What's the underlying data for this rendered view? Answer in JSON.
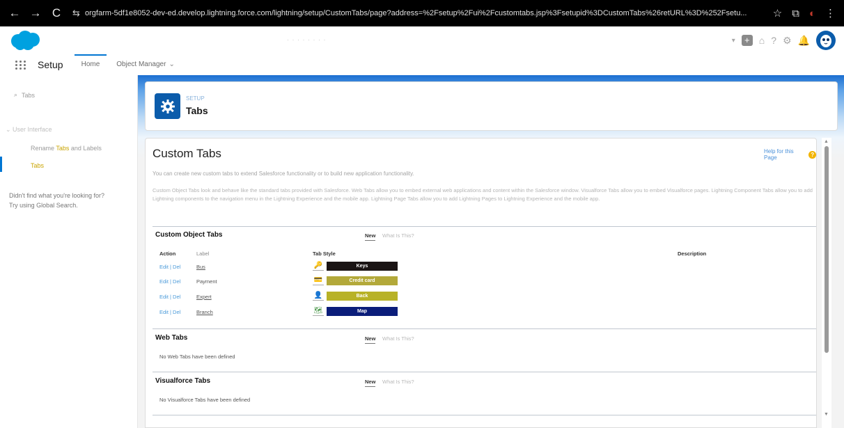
{
  "browser": {
    "back": "←",
    "forward": "→",
    "reload": "C",
    "tune": "⇆",
    "url": "orgfarm-5df1e8052-dev-ed.develop.lightning.force.com/lightning/setup/CustomTabs/page?address=%2Fsetup%2Fui%2Fcustomtabs.jsp%3Fsetupid%3DCustomTabs%26retURL%3D%252Fsetu...",
    "star": "☆",
    "extensions": "⧉",
    "profile": "◐",
    "menu": "⋮"
  },
  "header": {
    "search_placeholder": "· · · ·  · · · ·",
    "favorites": "▾",
    "plus": "+",
    "trailhead": "⌂",
    "help": "?",
    "settings": "⚙",
    "bell": "🔔"
  },
  "context": {
    "app_name": "Setup",
    "home_tab": "Home",
    "object_manager_tab": "Object Manager",
    "chevron": "⌄"
  },
  "sidebar": {
    "quickfind_icon": "⌕",
    "quickfind_value": "Tabs",
    "parent": "⌄ User Interface",
    "child1_pre": "Rename ",
    "child1_hl": "Tabs",
    "child1_post": " and Labels",
    "child2": "Tabs",
    "notfound1": "Didn't find what you're looking for?",
    "notfound2": "Try using Global Search."
  },
  "page_header": {
    "eyebrow": "SETUP",
    "title": "Tabs"
  },
  "content": {
    "title": "Custom Tabs",
    "help_link": "Help for this Page",
    "help_icon": "?",
    "intro": "You can create new custom tabs to extend Salesforce functionality or to build new application functionality.",
    "description": "Custom Object Tabs look and behave like the standard tabs provided with Salesforce. Web Tabs allow you to embed external web applications and content within the Salesforce window. Visualforce Tabs allow you to embed Visualforce pages. Lightning Component Tabs allow you to add Lightning components to the navigation menu in the Lightning Experience and the mobile app. Lightning Page Tabs allow you to add Lightning Pages to Lightning Experience and the mobile app.",
    "custom_object_tabs": {
      "title": "Custom Object Tabs",
      "new": "New",
      "what": "What Is This?",
      "col_action": "Action",
      "col_label": "Label",
      "col_style": "Tab Style",
      "col_description": "Description",
      "rows": [
        {
          "action": "Edit | Del",
          "label": "Bus",
          "style_label": "Keys",
          "icon": "🔑",
          "swatch_color": "#1a1414",
          "icon_color": "#e6a817"
        },
        {
          "action": "Edit | Del",
          "label": "Payment",
          "style_label": "Credit card",
          "icon": "💳",
          "swatch_color": "#b3a93a",
          "icon_color": "#3b7dd8"
        },
        {
          "action": "Edit | Del",
          "label": "Expert",
          "style_label": "Back",
          "icon": "👤",
          "swatch_color": "#b8b227",
          "icon_color": "#3aa13a"
        },
        {
          "action": "Edit | Del",
          "label": "Branch",
          "style_label": "Map",
          "icon": "🗺",
          "swatch_color": "#0b1d7a",
          "icon_color": "#4f9a4f"
        }
      ]
    },
    "web_tabs": {
      "title": "Web Tabs",
      "new": "New",
      "what": "What Is This?",
      "empty": "No Web Tabs have been defined"
    },
    "vf_tabs": {
      "title": "Visualforce Tabs",
      "new": "New",
      "what": "What Is This?",
      "empty": "No Visualforce Tabs have been defined"
    }
  },
  "scrollbar": {
    "up": "▲",
    "down": "▼"
  }
}
